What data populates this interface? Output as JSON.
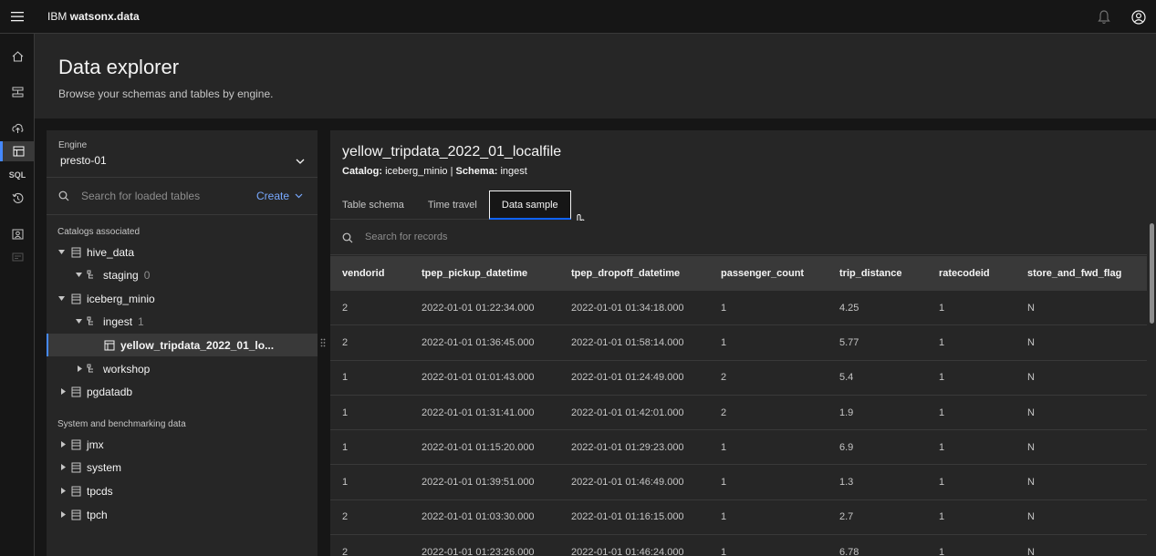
{
  "topbar": {
    "brand_prefix": "IBM ",
    "brand_name": "watsonx.data"
  },
  "rail": {
    "items": [
      "home-icon",
      "infrastructure-icon",
      "ingest-icon",
      "data-explorer-icon",
      "SQL",
      "history-icon",
      "access-icon",
      "certificate-icon"
    ]
  },
  "header": {
    "title": "Data explorer",
    "subtitle": "Browse your schemas and tables by engine."
  },
  "left": {
    "engine_label": "Engine",
    "engine_value": "presto-01",
    "search_placeholder": "Search for loaded tables",
    "create_label": "Create",
    "catalogs_title": "Catalogs associated",
    "system_title": "System and benchmarking data",
    "tree": [
      {
        "label": "hive_data",
        "count": ""
      },
      {
        "label": "staging",
        "count": "0"
      },
      {
        "label": "iceberg_minio",
        "count": ""
      },
      {
        "label": "ingest",
        "count": "1"
      },
      {
        "label": "yellow_tripdata_2022_01_lo...",
        "count": ""
      },
      {
        "label": "workshop",
        "count": ""
      },
      {
        "label": "pgdatadb",
        "count": ""
      }
    ],
    "system": [
      {
        "label": "jmx"
      },
      {
        "label": "system"
      },
      {
        "label": "tpcds"
      },
      {
        "label": "tpch"
      }
    ]
  },
  "right": {
    "table_name": "yellow_tripdata_2022_01_localfile",
    "catalog_label": "Catalog:",
    "catalog_value": "iceberg_minio",
    "separator": "|",
    "schema_label": "Schema:",
    "schema_value": "ingest",
    "tabs": [
      "Table schema",
      "Time travel",
      "Data sample"
    ],
    "active_tab": "Data sample",
    "records_placeholder": "Search for records",
    "columns": [
      "vendorid",
      "tpep_pickup_datetime",
      "tpep_dropoff_datetime",
      "passenger_count",
      "trip_distance",
      "ratecodeid",
      "store_and_fwd_flag"
    ],
    "rows": [
      [
        "2",
        "2022-01-01 01:22:34.000",
        "2022-01-01 01:34:18.000",
        "1",
        "4.25",
        "1",
        "N"
      ],
      [
        "2",
        "2022-01-01 01:36:45.000",
        "2022-01-01 01:58:14.000",
        "1",
        "5.77",
        "1",
        "N"
      ],
      [
        "1",
        "2022-01-01 01:01:43.000",
        "2022-01-01 01:24:49.000",
        "2",
        "5.4",
        "1",
        "N"
      ],
      [
        "1",
        "2022-01-01 01:31:41.000",
        "2022-01-01 01:42:01.000",
        "2",
        "1.9",
        "1",
        "N"
      ],
      [
        "1",
        "2022-01-01 01:15:20.000",
        "2022-01-01 01:29:23.000",
        "1",
        "6.9",
        "1",
        "N"
      ],
      [
        "1",
        "2022-01-01 01:39:51.000",
        "2022-01-01 01:46:49.000",
        "1",
        "1.3",
        "1",
        "N"
      ],
      [
        "2",
        "2022-01-01 01:03:30.000",
        "2022-01-01 01:16:15.000",
        "1",
        "2.7",
        "1",
        "N"
      ],
      [
        "2",
        "2022-01-01 01:23:26.000",
        "2022-01-01 01:46:24.000",
        "1",
        "6.78",
        "1",
        "N"
      ]
    ]
  },
  "colors": {
    "accent": "#4589ff",
    "link": "#78a9ff",
    "tab_underline": "#0f62fe"
  }
}
